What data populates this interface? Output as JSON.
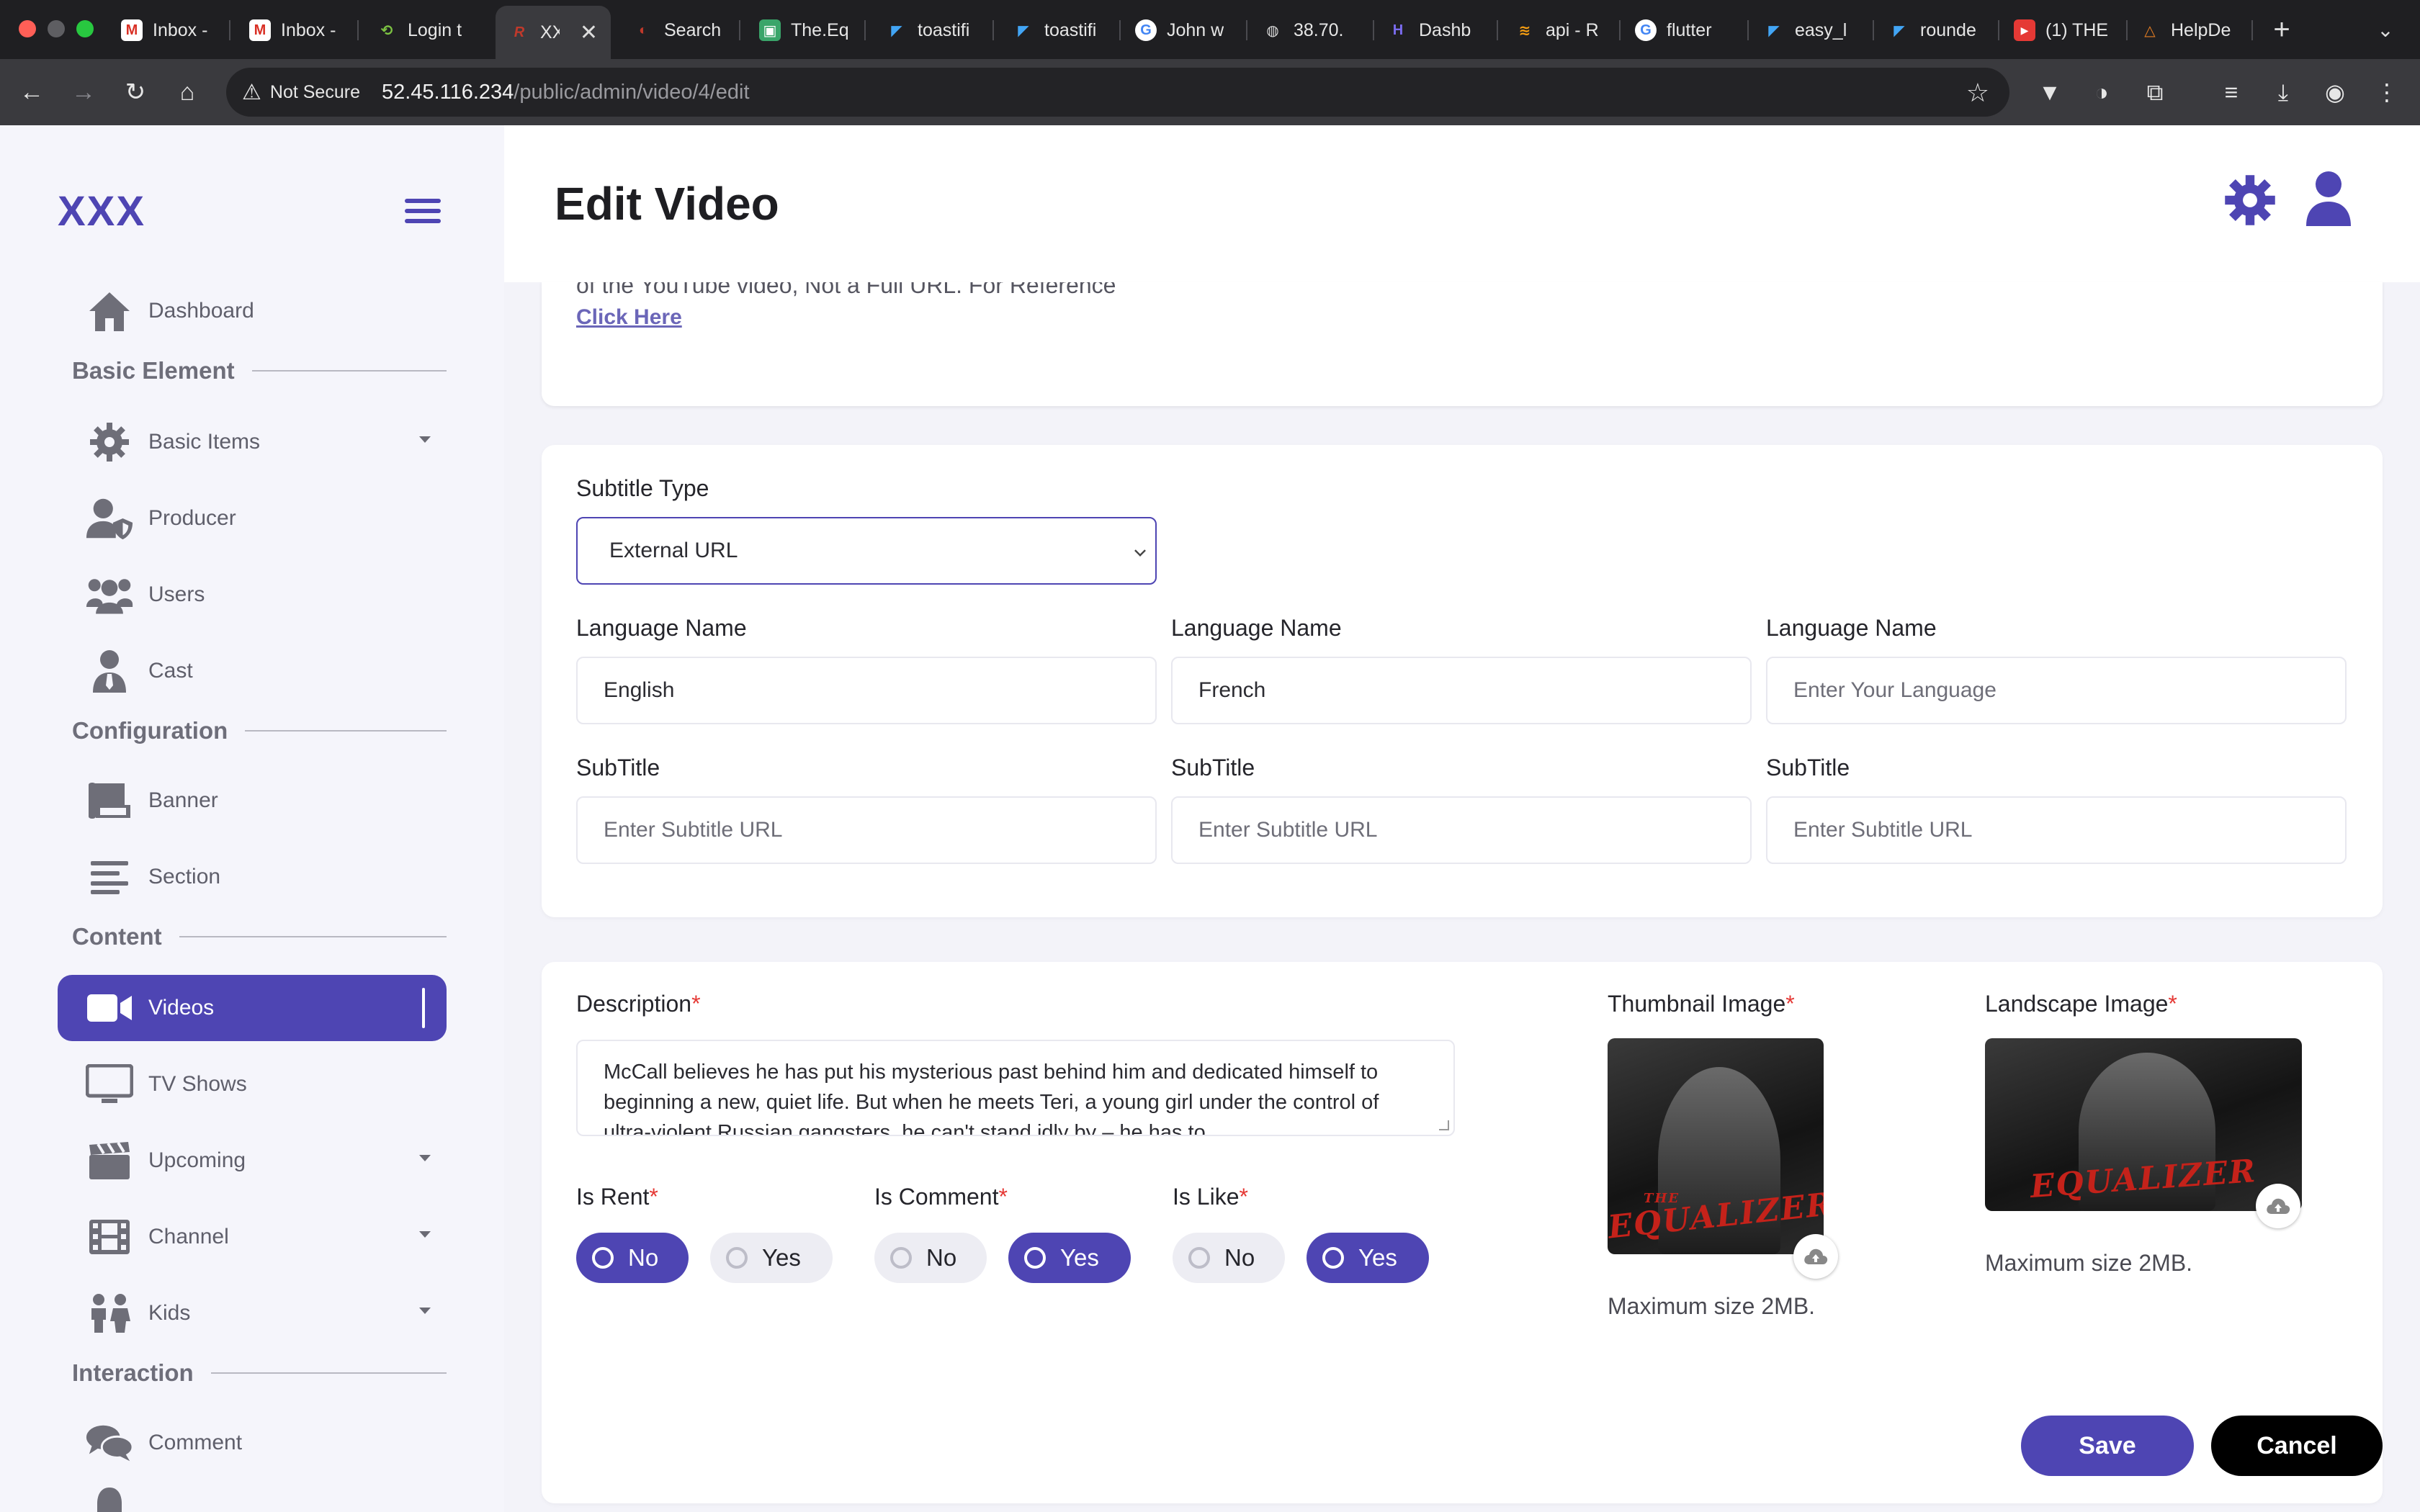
{
  "browser": {
    "tabs": [
      {
        "title": "Inbox -",
        "favicon": "gmail-icon"
      },
      {
        "title": "Inbox -",
        "favicon": "gmail-icon"
      },
      {
        "title": "Login t",
        "favicon": "link-icon"
      },
      {
        "title": "XX",
        "favicon": "app-icon",
        "active": true
      },
      {
        "title": "Search",
        "favicon": "search-icon"
      },
      {
        "title": "The.Eq",
        "favicon": "doc-icon"
      },
      {
        "title": "toastifi",
        "favicon": "flutter-icon"
      },
      {
        "title": "toastifi",
        "favicon": "flutter-icon"
      },
      {
        "title": "John w",
        "favicon": "google-icon"
      },
      {
        "title": "38.70.",
        "favicon": "globe-icon"
      },
      {
        "title": "Dashb",
        "favicon": "dashboard-icon"
      },
      {
        "title": "api - R",
        "favicon": "api-icon"
      },
      {
        "title": "flutter",
        "favicon": "google-icon"
      },
      {
        "title": "easy_l",
        "favicon": "flutter-icon"
      },
      {
        "title": "rounde",
        "favicon": "flutter-icon"
      },
      {
        "title": "(1) THE",
        "favicon": "youtube-icon"
      },
      {
        "title": "HelpDe",
        "favicon": "helpdesk-icon"
      }
    ],
    "not_secure": "Not Secure",
    "url_host": "52.45.116.234",
    "url_path": "/public/admin/video/4/edit"
  },
  "app": {
    "brand": "XXX",
    "page_title": "Edit Video"
  },
  "sidebar": {
    "items": [
      {
        "label": "Dashboard",
        "icon": "home-icon"
      },
      {
        "label": "Basic Items",
        "icon": "gear-icon",
        "dropdown": true
      },
      {
        "label": "Producer",
        "icon": "user-shield-icon"
      },
      {
        "label": "Users",
        "icon": "users-icon"
      },
      {
        "label": "Cast",
        "icon": "user-tie-icon"
      },
      {
        "label": "Banner",
        "icon": "banner-icon"
      },
      {
        "label": "Section",
        "icon": "list-icon"
      },
      {
        "label": "Videos",
        "icon": "video-camera-icon",
        "active": true
      },
      {
        "label": "TV Shows",
        "icon": "tv-icon"
      },
      {
        "label": "Upcoming",
        "icon": "clapperboard-icon",
        "dropdown": true
      },
      {
        "label": "Channel",
        "icon": "film-icon",
        "dropdown": true
      },
      {
        "label": "Kids",
        "icon": "children-icon",
        "dropdown": true
      },
      {
        "label": "Comment",
        "icon": "comments-icon"
      }
    ],
    "sections": [
      "Basic Element",
      "Configuration",
      "Content",
      "Interaction"
    ]
  },
  "form": {
    "youtube_hint": "of the YouTube video, Not a Full URL. For Reference",
    "click_here": "Click Here",
    "subtitle_type_label": "Subtitle Type",
    "subtitle_type_value": "External URL",
    "language_label": "Language Name",
    "languages": [
      {
        "value": "English",
        "placeholder": ""
      },
      {
        "value": "French",
        "placeholder": ""
      },
      {
        "value": "",
        "placeholder": "Enter Your Language"
      }
    ],
    "subtitle_label": "SubTitle",
    "subtitle_placeholder": "Enter Subtitle URL",
    "description_label": "Description",
    "description": "McCall believes he has put his mysterious past behind him and dedicated himself to beginning a new, quiet life. But when he meets Teri, a young girl under the control of ultra-violent Russian gangsters, he can't stand idly by – he has to",
    "required_mark": "*",
    "is_rent_label": "Is Rent",
    "is_comment_label": "Is Comment",
    "is_like_label": "Is Like",
    "no_label": "No",
    "yes_label": "Yes",
    "is_rent": "No",
    "is_comment": "Yes",
    "is_like": "Yes",
    "thumbnail_label": "Thumbnail Image",
    "landscape_label": "Landscape Image",
    "max_size": "Maximum size 2MB.",
    "poster_title": "EQUALIZER",
    "poster_prefix": "THE"
  },
  "actions": {
    "save": "Save",
    "cancel": "Cancel"
  },
  "colors": {
    "accent": "#4e45b3",
    "danger": "#e53935",
    "cancel": "#000000"
  }
}
